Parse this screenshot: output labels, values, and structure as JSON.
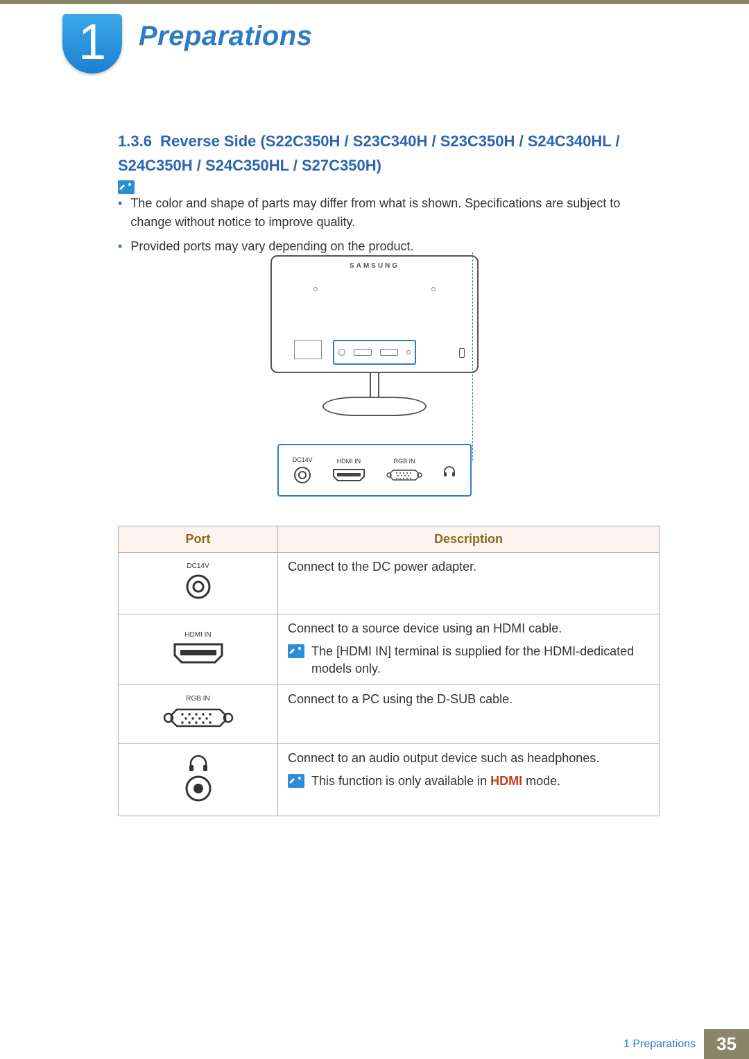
{
  "chapter": {
    "number": "1",
    "title": "Preparations"
  },
  "section": {
    "number": "1.3.6",
    "title": "Reverse Side (S22C350H / S23C340H / S23C350H / S24C340HL / S24C350H / S24C350HL / S27C350H)"
  },
  "notes": [
    "The color and shape of parts may differ from what is shown. Specifications are subject to change without notice to improve quality.",
    "Provided ports may vary depending on the product."
  ],
  "diagram": {
    "brand": "SAMSUNG",
    "ports": [
      {
        "label": "DC14V",
        "kind": "dc"
      },
      {
        "label": "HDMI IN",
        "kind": "hdmi"
      },
      {
        "label": "RGB IN",
        "kind": "vga"
      },
      {
        "label": "",
        "kind": "headphone"
      }
    ]
  },
  "table": {
    "headers": {
      "port": "Port",
      "description": "Description"
    },
    "rows": [
      {
        "port_label": "DC14V",
        "port_kind": "dc",
        "description": "Connect to the DC power adapter.",
        "note": null
      },
      {
        "port_label": "HDMI IN",
        "port_kind": "hdmi",
        "description": "Connect to a source device using an HDMI cable.",
        "note": "The [HDMI IN] terminal is supplied for the HDMI-dedicated models only."
      },
      {
        "port_label": "RGB IN",
        "port_kind": "vga",
        "description": "Connect to a PC using the D-SUB cable.",
        "note": null
      },
      {
        "port_label": "",
        "port_kind": "headphone",
        "description": "Connect to an audio output device such as headphones.",
        "note_prefix": "This function is only available in ",
        "note_em": "HDMI",
        "note_suffix": " mode."
      }
    ]
  },
  "footer": {
    "chapter_ref": "1 Preparations",
    "page": "35"
  }
}
